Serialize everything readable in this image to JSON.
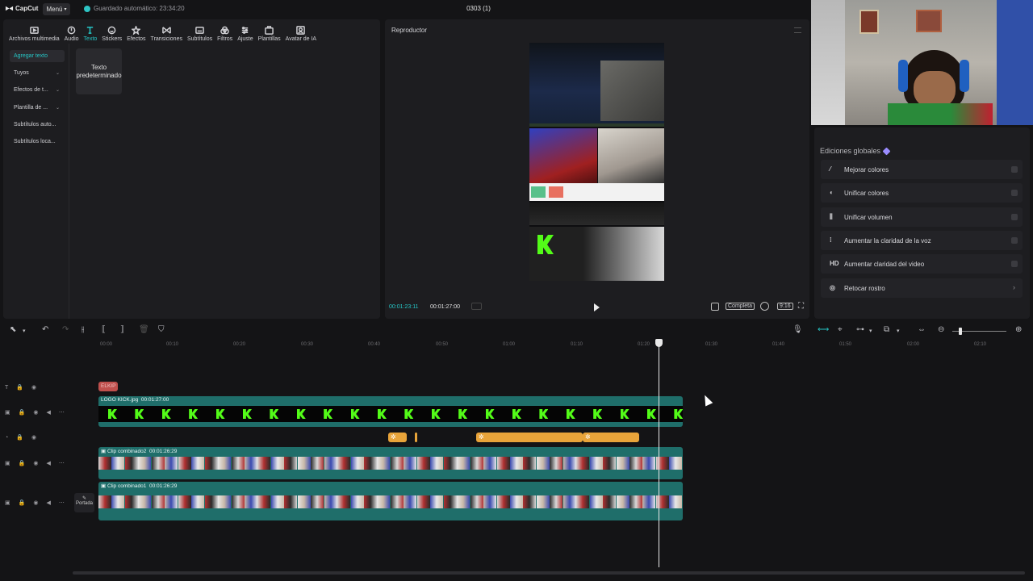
{
  "app": {
    "logo_text": "CapCut",
    "menu_label": "Menú",
    "autosave_text": "Guardado automático: 23:34:20",
    "project_title": "0303 (1)"
  },
  "toolbar": {
    "tools": [
      {
        "label": "Archivos multimedia",
        "icon": "media-icon"
      },
      {
        "label": "Audio",
        "icon": "audio-icon"
      },
      {
        "label": "Texto",
        "icon": "text-icon",
        "active": true
      },
      {
        "label": "Stickers",
        "icon": "sticker-icon"
      },
      {
        "label": "Efectos",
        "icon": "effects-icon"
      },
      {
        "label": "Transiciones",
        "icon": "transitions-icon"
      },
      {
        "label": "Subtítulos",
        "icon": "subtitles-icon"
      },
      {
        "label": "Filtros",
        "icon": "filters-icon"
      },
      {
        "label": "Ajuste",
        "icon": "adjust-icon"
      },
      {
        "label": "Plantillas",
        "icon": "templates-icon"
      },
      {
        "label": "Avatar de IA",
        "icon": "ai-avatar-icon"
      }
    ]
  },
  "text_nav": {
    "items": [
      "Agregar texto",
      "Tuyos",
      "Efectos de t...",
      "Plantilla de ...",
      "Subtítulos auto...",
      "Subtítulos loca..."
    ]
  },
  "text_card": {
    "label": "Texto predeterminado"
  },
  "player": {
    "title": "Reproductor",
    "current_time": "00:01:23:11",
    "total_time": "00:01:27:00",
    "quality_label": "Completa",
    "ratio_label": "9:16"
  },
  "right_panel": {
    "title": "Ediciones globales",
    "items": [
      {
        "label": "Mejorar colores",
        "icon": "wand-icon"
      },
      {
        "label": "Unificar colores",
        "icon": "palette-icon"
      },
      {
        "label": "Unificar volumen",
        "icon": "volume-bars-icon"
      },
      {
        "label": "Aumentar la claridad de la voz",
        "icon": "voice-sparkle-icon"
      },
      {
        "label": "Aumentar claridad del video",
        "icon": "hd-icon"
      },
      {
        "label": "Retocar rostro",
        "icon": "face-retouch-icon"
      }
    ]
  },
  "timeline": {
    "ruler": [
      "00:00",
      "00:10",
      "00:20",
      "00:30",
      "00:40",
      "00:50",
      "01:00",
      "01:10",
      "01:20",
      "01:30",
      "01:40",
      "01:50",
      "02:00",
      "02:10"
    ],
    "text_clip": {
      "label": "ELKIP"
    },
    "logo_clip": {
      "label": "LOGO KICK.jpg",
      "duration": "00:01:27:00"
    },
    "combo2": {
      "label": "Clip combinado2",
      "duration": "00:01:26:29"
    },
    "combo1": {
      "label": "Clip combinado1",
      "duration": "00:01:26:29"
    },
    "cover_label": "Portada"
  },
  "colors": {
    "accent": "#26c6c6",
    "track_teal": "#1f6e6a",
    "kick_green": "#53fc18",
    "effect_orange": "#e8a43a",
    "text_clip_red": "#c0504d"
  }
}
